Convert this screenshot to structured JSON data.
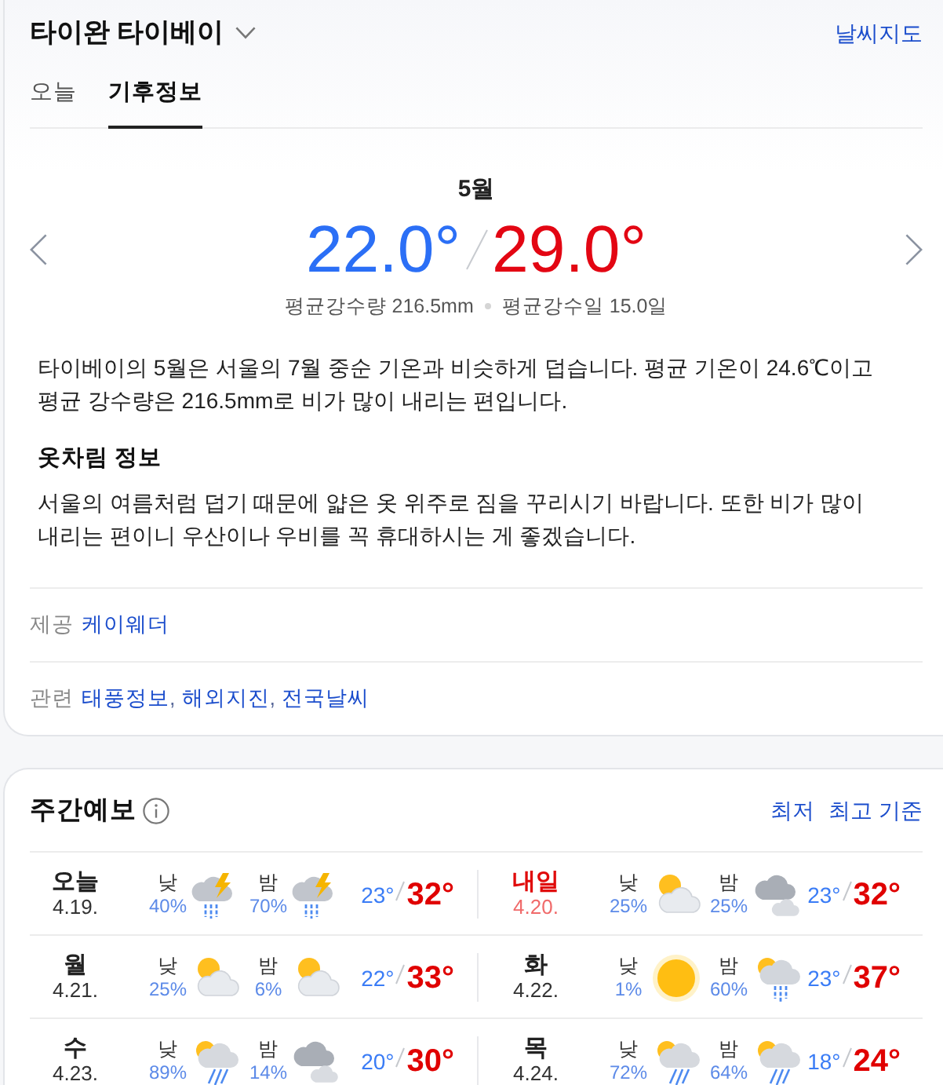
{
  "header": {
    "title": "타이완 타이베이",
    "map_link": "날씨지도"
  },
  "tabs": [
    {
      "label": "오늘",
      "selected": false
    },
    {
      "label": "기후정보",
      "selected": true
    }
  ],
  "climate": {
    "month": "5월",
    "low": "22.0°",
    "high": "29.0°",
    "stats": [
      "평균강수량 216.5mm",
      "평균강수일 15.0일"
    ],
    "description": "타이베이의 5월은 서울의 7월 중순 기온과 비슷하게 덥습니다. 평균 기온이 24.6℃이고 평균 강수량은 216.5mm로 비가 많이 내리는 편입니다.",
    "clothing": {
      "title": "옷차림 정보",
      "text": "서울의 여름처럼 덥기 때문에 얇은 옷 위주로 짐을 꾸리시기 바랍니다. 또한 비가 많이 내리는 편이니 우산이나 우비를 꼭 휴대하시는 게 좋겠습니다."
    }
  },
  "provider": {
    "label": "제공",
    "links": [
      "케이웨더"
    ]
  },
  "related": {
    "label": "관련",
    "links": [
      "태풍정보",
      "해외지진",
      "전국날씨"
    ],
    "separator": ","
  },
  "weekly": {
    "title": "주간예보",
    "sort_options": [
      "최저",
      "최고 기준"
    ],
    "days": [
      {
        "day": "오늘",
        "date": "4.19.",
        "holiday": false,
        "periods": [
          {
            "label": "낮",
            "chance": "40%",
            "kind": "thunder_rain"
          },
          {
            "label": "밤",
            "chance": "70%",
            "kind": "thunder_rain"
          }
        ],
        "low": "23°",
        "high": "32°"
      },
      {
        "day": "내일",
        "date": "4.20.",
        "holiday": true,
        "periods": [
          {
            "label": "낮",
            "chance": "25%",
            "kind": "partly_cloudy"
          },
          {
            "label": "밤",
            "chance": "25%",
            "kind": "cloudy"
          }
        ],
        "low": "23°",
        "high": "32°"
      },
      {
        "day": "월",
        "date": "4.21.",
        "holiday": false,
        "periods": [
          {
            "label": "낮",
            "chance": "25%",
            "kind": "partly_cloudy"
          },
          {
            "label": "밤",
            "chance": "6%",
            "kind": "partly_cloudy"
          }
        ],
        "low": "22°",
        "high": "33°"
      },
      {
        "day": "화",
        "date": "4.22.",
        "holiday": false,
        "periods": [
          {
            "label": "낮",
            "chance": "1%",
            "kind": "sunny"
          },
          {
            "label": "밤",
            "chance": "60%",
            "kind": "sun_rain"
          }
        ],
        "low": "23°",
        "high": "37°"
      },
      {
        "day": "수",
        "date": "4.23.",
        "holiday": false,
        "periods": [
          {
            "label": "낮",
            "chance": "89%",
            "kind": "sun_shower"
          },
          {
            "label": "밤",
            "chance": "14%",
            "kind": "cloudy"
          }
        ],
        "low": "20°",
        "high": "30°"
      },
      {
        "day": "목",
        "date": "4.24.",
        "holiday": false,
        "periods": [
          {
            "label": "낮",
            "chance": "72%",
            "kind": "sun_shower"
          },
          {
            "label": "밤",
            "chance": "64%",
            "kind": "sun_shower"
          }
        ],
        "low": "18°",
        "high": "24°"
      }
    ]
  }
}
